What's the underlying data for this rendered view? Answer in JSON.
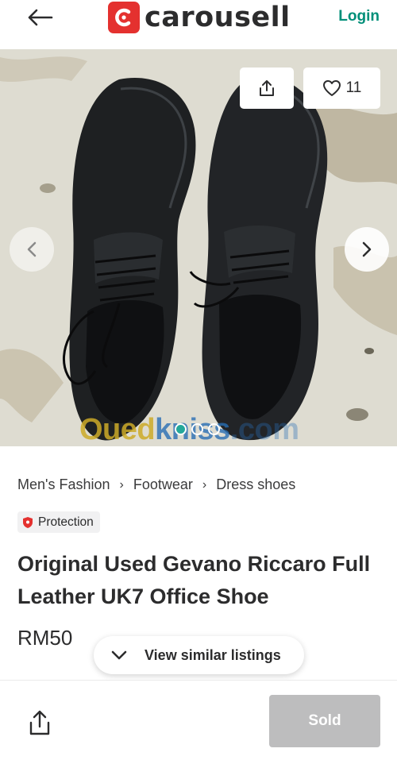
{
  "header": {
    "logo_text": "carousell",
    "login_label": "Login",
    "back_icon": "arrow-left-icon",
    "brand_color": "#e4312f",
    "accent_color": "#008f79"
  },
  "gallery": {
    "like_count": "11",
    "share_icon": "share-icon",
    "like_icon": "heart-icon",
    "current_image": 1,
    "total_images": 3,
    "watermark_part1": "Oued",
    "watermark_part2": "kniss",
    "watermark_part3": ".com"
  },
  "breadcrumb": {
    "items": [
      "Men's Fashion",
      "Footwear",
      "Dress shoes"
    ]
  },
  "protection_label": "Protection",
  "listing": {
    "title": "Original Used Gevano Riccaro Full Leather UK7 Office Shoe",
    "price": "RM50"
  },
  "similar_label": "View similar listings",
  "bottom_bar": {
    "sold_label": "Sold",
    "sold_color": "#bdbdbe"
  }
}
